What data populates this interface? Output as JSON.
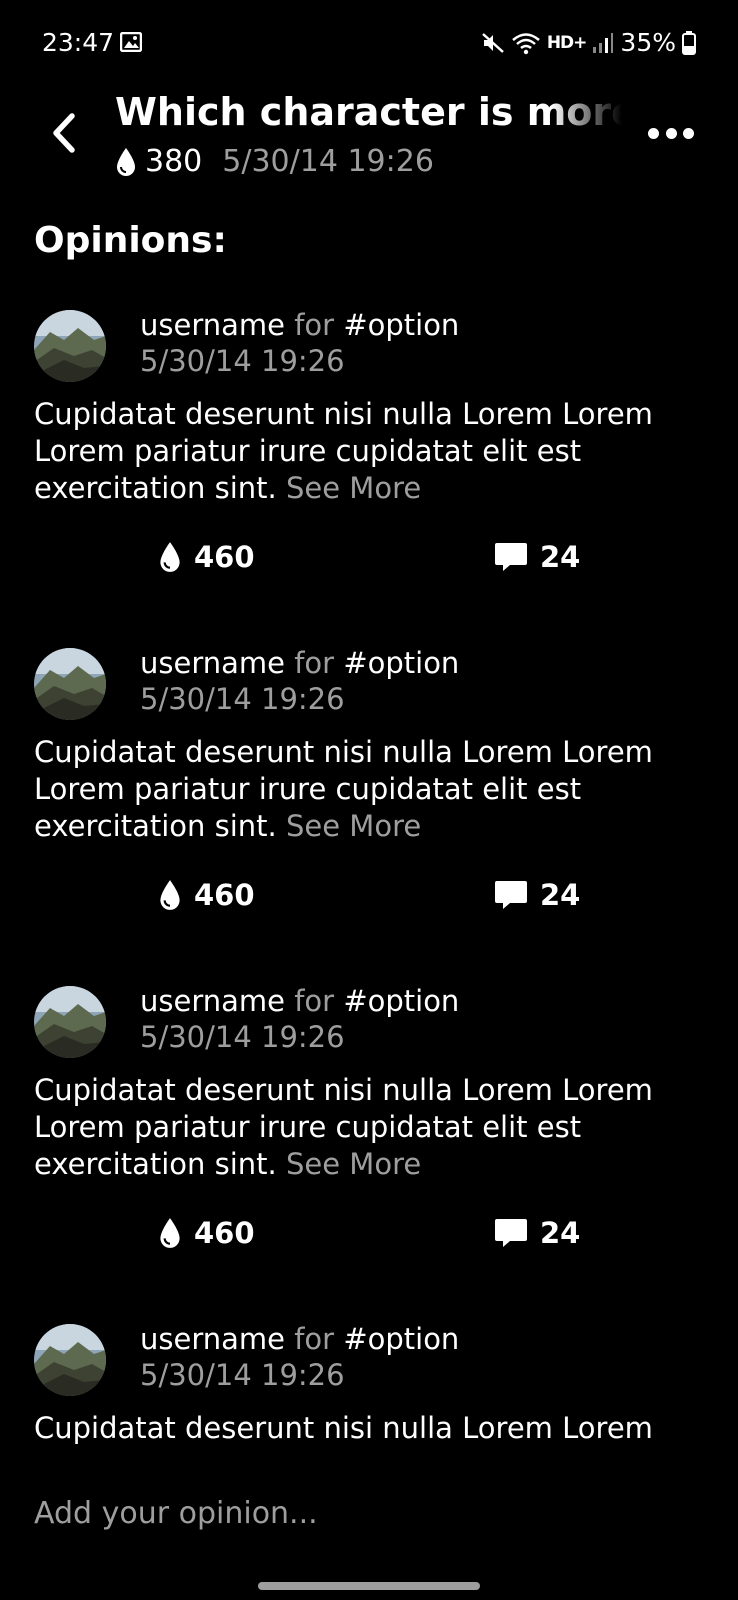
{
  "status_bar": {
    "time": "23:47",
    "hd_label": "HD+",
    "battery": "35%",
    "icons": [
      "gallery-icon",
      "mute-icon",
      "wifi-icon",
      "signal-icon",
      "battery-icon"
    ]
  },
  "header": {
    "title": "Which character is more li",
    "votes": "380",
    "date": "5/30/14 19:26",
    "icons": [
      "back-icon",
      "drop-icon",
      "more-icon"
    ]
  },
  "section_title": "Opinions:",
  "opinions": [
    {
      "username": "username",
      "for_word": "for",
      "option": "#option",
      "date": "5/30/14 19:26",
      "text": "Cupidatat deserunt nisi nulla Lorem Lorem Lorem pariatur irure cupidatat elit est exercitation sint.",
      "see_more": "See More",
      "votes": "460",
      "comments": "24"
    },
    {
      "username": "username",
      "for_word": "for",
      "option": "#option",
      "date": "5/30/14 19:26",
      "text": "Cupidatat deserunt nisi nulla Lorem Lorem Lorem pariatur irure cupidatat elit est exercitation sint.",
      "see_more": "See More",
      "votes": "460",
      "comments": "24"
    },
    {
      "username": "username",
      "for_word": "for",
      "option": "#option",
      "date": "5/30/14 19:26",
      "text": "Cupidatat deserunt nisi nulla Lorem Lorem Lorem pariatur irure cupidatat elit est exercitation sint.",
      "see_more": "See More",
      "votes": "460",
      "comments": "24"
    },
    {
      "username": "username",
      "for_word": "for",
      "option": "#option",
      "date": "5/30/14 19:26",
      "text": "Cupidatat deserunt nisi nulla Lorem Lorem",
      "see_more": "",
      "votes": "",
      "comments": ""
    }
  ],
  "input": {
    "placeholder": "Add your opinion..."
  },
  "colors": {
    "background": "#000000",
    "text": "#ffffff",
    "secondary_text": "#9e9e9e"
  }
}
